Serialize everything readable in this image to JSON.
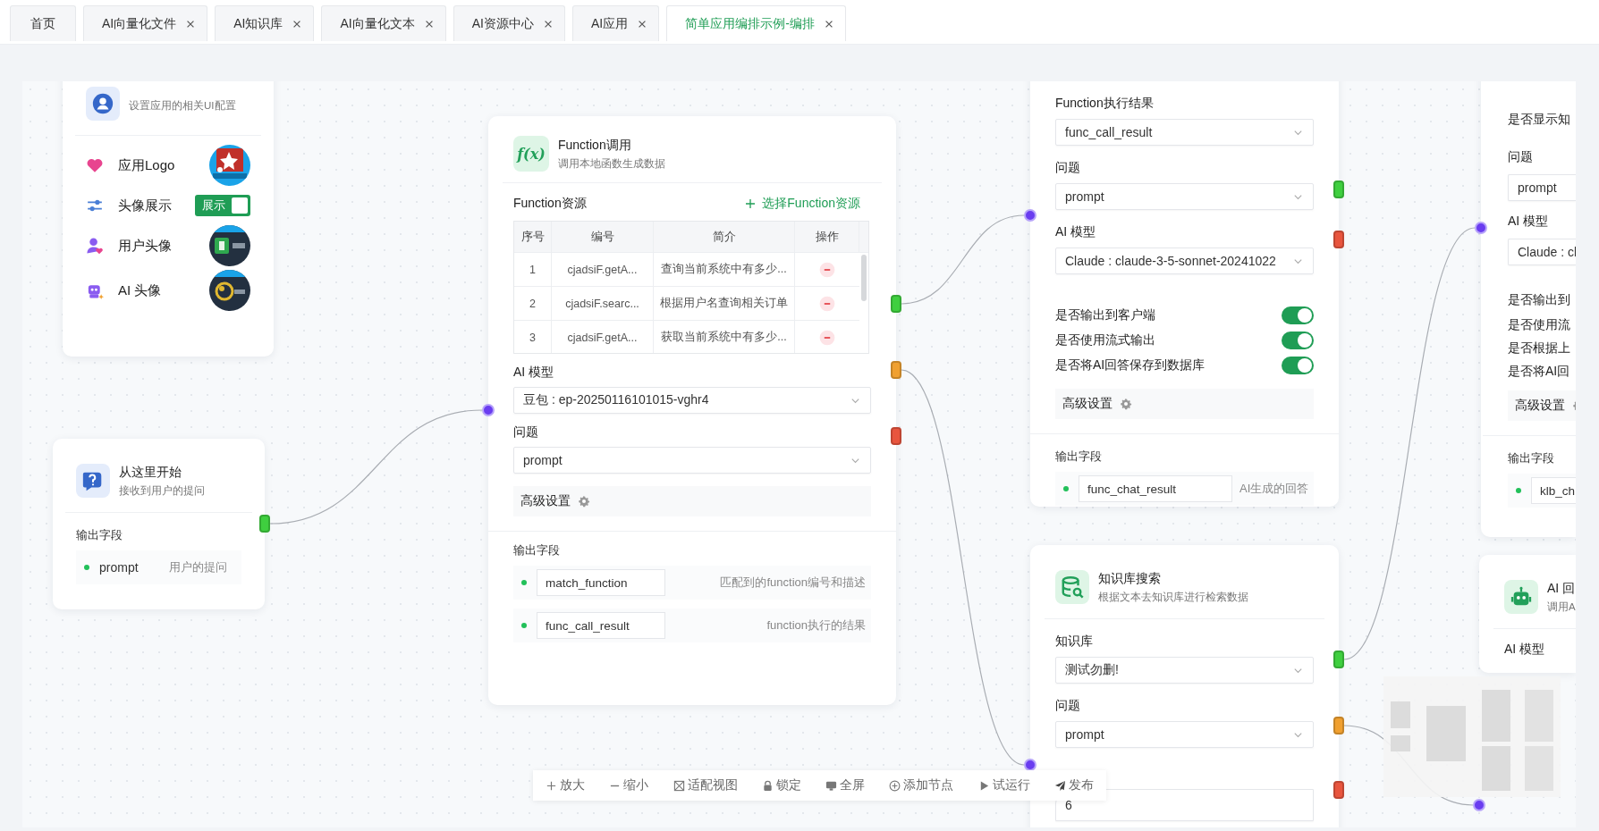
{
  "tabs": [
    {
      "label": "首页",
      "closable": false,
      "selected": false
    },
    {
      "label": "AI向量化文件",
      "closable": true,
      "selected": false
    },
    {
      "label": "AI知识库",
      "closable": true,
      "selected": false
    },
    {
      "label": "AI向量化文本",
      "closable": true,
      "selected": false
    },
    {
      "label": "AI资源中心",
      "closable": true,
      "selected": false
    },
    {
      "label": "AI应用",
      "closable": true,
      "selected": false
    },
    {
      "label": "简单应用编排示例-编排",
      "closable": true,
      "selected": true
    }
  ],
  "nodes": [
    {
      "kind": "app_settings",
      "subtitle": "设置应用的相关UI配置",
      "input": false,
      "clipped": false,
      "sections": [
        {
          "kind": "avatar",
          "label": "应用Logo"
        },
        {
          "kind": "labeled_switch",
          "label": "头像展示",
          "text": "展示",
          "on": true
        },
        {
          "kind": "avatar",
          "label": "用户头像"
        },
        {
          "kind": "avatar",
          "label": "AI  头像"
        }
      ]
    },
    {
      "kind": "start",
      "title": "从这里开始",
      "subtitle": "接收到用户的提问",
      "input": false,
      "clipped": false,
      "ports": [
        {
          "color": "#3fcf3f"
        }
      ],
      "sections": [
        {
          "kind": "outputs",
          "label": "输出字段",
          "boxed": false,
          "items": [
            {
              "name": "prompt",
              "desc": "用户的提问"
            }
          ]
        }
      ]
    },
    {
      "kind": "function",
      "icon_text": "f(x)",
      "title": "Function调用",
      "subtitle": "调用本地函数生成数据",
      "input": true,
      "clipped": false,
      "ports": [
        {
          "color": "#3fcf3f"
        },
        {
          "color": "#f0a030"
        },
        {
          "color": "#e8553e"
        }
      ],
      "sections": [
        {
          "kind": "resource_table",
          "label": "Function资源",
          "action": "选择Function资源",
          "columns": [
            "序号",
            "编号",
            "简介",
            "操作"
          ],
          "rows": [
            [
              "1",
              "cjadsiF.getA...",
              "查询当前系统中有多少..."
            ],
            [
              "2",
              "cjadsiF.searc...",
              "根据用户名查询相关订单"
            ],
            [
              "3",
              "cjadsiF.getA...",
              "获取当前系统中有多少..."
            ]
          ]
        },
        {
          "kind": "select",
          "label": "AI 模型",
          "value": "豆包 : ep-20250116101015-vghr4"
        },
        {
          "kind": "select",
          "label": "问题",
          "value": "prompt"
        },
        {
          "kind": "advanced",
          "label": "高级设置"
        },
        {
          "kind": "outputs",
          "label": "输出字段",
          "boxed": true,
          "items": [
            {
              "name": "match_function",
              "desc": "匹配到的function编号和描述"
            },
            {
              "name": "func_call_result",
              "desc": "function执行的结果"
            }
          ]
        }
      ]
    },
    {
      "kind": "llm",
      "input": true,
      "clipped": false,
      "ports": [
        {
          "color": "#3fcf3f"
        },
        {
          "color": "#e8553e"
        }
      ],
      "sections": [
        {
          "kind": "select",
          "label": "Function执行结果",
          "value": "func_call_result"
        },
        {
          "kind": "select",
          "label": "问题",
          "value": "prompt"
        },
        {
          "kind": "select",
          "label": "AI 模型",
          "value": "Claude : claude-3-5-sonnet-20241022"
        },
        {
          "kind": "switch",
          "label": "是否输出到客户端",
          "on": true
        },
        {
          "kind": "switch",
          "label": "是否使用流式输出",
          "on": true
        },
        {
          "kind": "switch",
          "label": "是否将AI回答保存到数据库",
          "on": true
        },
        {
          "kind": "advanced",
          "label": "高级设置"
        },
        {
          "kind": "outputs",
          "label": "输出字段",
          "boxed": true,
          "items": [
            {
              "name": "func_chat_result",
              "desc": "AI生成的回答"
            }
          ]
        }
      ]
    },
    {
      "kind": "knowledge_search",
      "title": "知识库搜索",
      "subtitle": "根据文本去知识库进行检索数据",
      "input": true,
      "clipped": false,
      "ports": [
        {
          "color": "#3fcf3f"
        },
        {
          "color": "#f0a030"
        },
        {
          "color": "#e8553e"
        }
      ],
      "sections": [
        {
          "kind": "select",
          "label": "知识库",
          "value": "测试勿删!"
        },
        {
          "kind": "select",
          "label": "问题",
          "value": "prompt"
        },
        {
          "kind": "number",
          "value": "6"
        }
      ]
    },
    {
      "kind": "llm",
      "input": true,
      "clipped": true,
      "sections": [
        {
          "kind": "label",
          "label": "是否显示知"
        },
        {
          "kind": "select",
          "label": "问题",
          "value": "prompt"
        },
        {
          "kind": "select",
          "label": "AI 模型",
          "value": "Claude : cl"
        },
        {
          "kind": "label",
          "label": "是否输出到"
        },
        {
          "kind": "label",
          "label": "是否使用流"
        },
        {
          "kind": "label",
          "label": "是否根据上"
        },
        {
          "kind": "label",
          "label": "是否将AI回"
        },
        {
          "kind": "advanced",
          "label": "高级设置"
        },
        {
          "kind": "outputs",
          "label": "输出字段",
          "boxed": true,
          "items": [
            {
              "name": "klb_ch"
            }
          ]
        }
      ]
    },
    {
      "kind": "ai_answer",
      "title": "AI 回",
      "subtitle": "调用A",
      "input": true,
      "clipped": true,
      "sections": [
        {
          "kind": "label",
          "label": "AI 模型"
        }
      ]
    }
  ],
  "toolbar": [
    {
      "label": "放大"
    },
    {
      "label": "缩小"
    },
    {
      "label": "适配视图"
    },
    {
      "label": "锁定"
    },
    {
      "label": "全屏"
    },
    {
      "label": "添加节点"
    },
    {
      "label": "试运行"
    },
    {
      "label": "发布"
    }
  ]
}
